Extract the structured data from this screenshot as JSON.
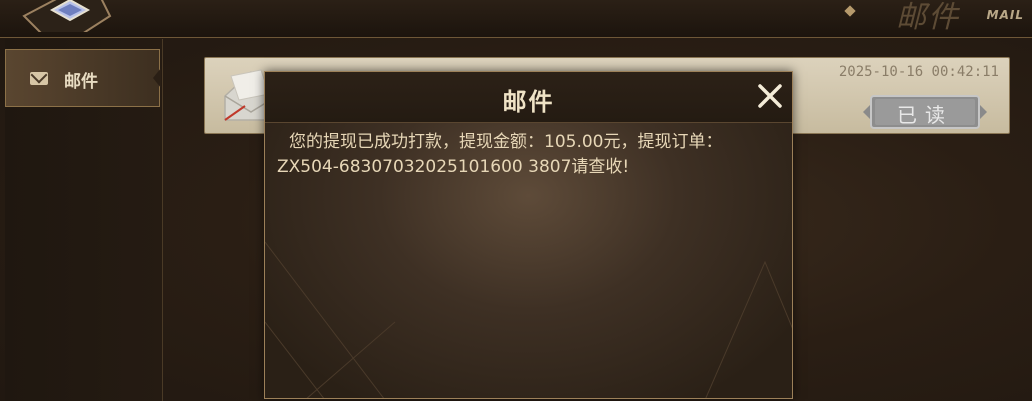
{
  "header": {
    "title": "邮件",
    "subtitle": "MAIL"
  },
  "sidebar": {
    "items": [
      {
        "label": "邮件",
        "icon": "envelope-icon",
        "active": true
      }
    ]
  },
  "mail_list": [
    {
      "date": "2025-10-16 00:42:11",
      "status_button": "已读",
      "icon": "open-envelope-icon"
    }
  ],
  "dialog": {
    "title": "邮件",
    "body": "您的提现已成功打款，提现金额：105.00元，提现订单：ZX504-68307032025101600 3807请查收!"
  },
  "colors": {
    "accent_gold": "#b69a6c",
    "card_bg": "#dcd2bc",
    "button_grey": "#8b8b8b"
  }
}
